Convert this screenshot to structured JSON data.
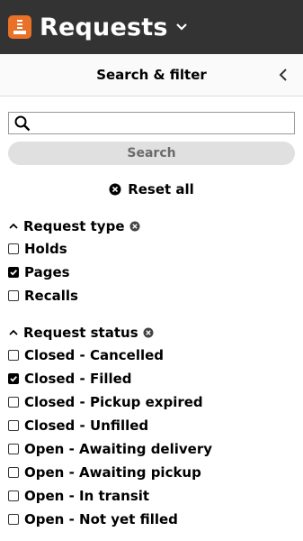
{
  "header": {
    "app_title": "Requests",
    "app_icon": "requests-app-icon",
    "accent": "#e97128",
    "bar_color": "#333333"
  },
  "pane": {
    "title": "Search & filter",
    "collapse_icon": "chevron-left-icon"
  },
  "search": {
    "value": "",
    "placeholder": "",
    "button_label": "Search"
  },
  "reset": {
    "label": "Reset all"
  },
  "filters": {
    "request_type": {
      "label": "Request type",
      "options": [
        {
          "label": "Holds",
          "checked": false
        },
        {
          "label": "Pages",
          "checked": true
        },
        {
          "label": "Recalls",
          "checked": false
        }
      ]
    },
    "request_status": {
      "label": "Request status",
      "options": [
        {
          "label": "Closed - Cancelled",
          "checked": false
        },
        {
          "label": "Closed - Filled",
          "checked": true
        },
        {
          "label": "Closed - Pickup expired",
          "checked": false
        },
        {
          "label": "Closed - Unfilled",
          "checked": false
        },
        {
          "label": "Open - Awaiting delivery",
          "checked": false
        },
        {
          "label": "Open - Awaiting pickup",
          "checked": false
        },
        {
          "label": "Open - In transit",
          "checked": false
        },
        {
          "label": "Open - Not yet filled",
          "checked": false
        }
      ]
    }
  }
}
